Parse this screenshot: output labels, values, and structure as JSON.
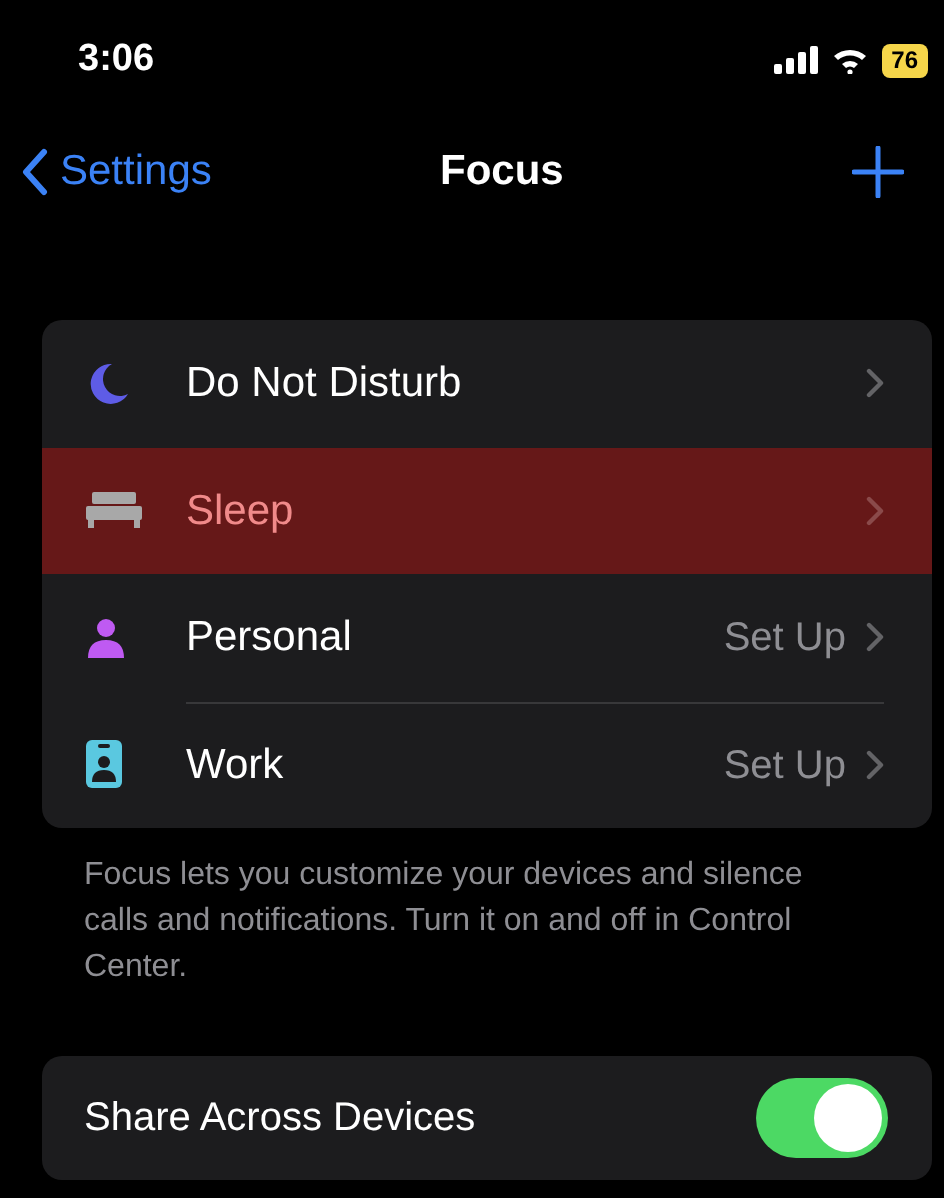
{
  "status_bar": {
    "time": "3:06",
    "battery": "76"
  },
  "nav": {
    "back": "Settings",
    "title": "Focus"
  },
  "focus_modes": [
    {
      "kind": "moon",
      "label": "Do Not Disturb",
      "selected": false
    },
    {
      "kind": "bed",
      "label": "Sleep",
      "selected": true
    },
    {
      "kind": "person",
      "label": "Personal",
      "detail": "Set Up",
      "selected": false
    },
    {
      "kind": "badge",
      "label": "Work",
      "detail": "Set Up",
      "selected": false
    }
  ],
  "footer": "Focus lets you customize your devices and silence calls and notifications. Turn it on and off in Control Center.",
  "share": {
    "label": "Share Across Devices",
    "on": true
  }
}
